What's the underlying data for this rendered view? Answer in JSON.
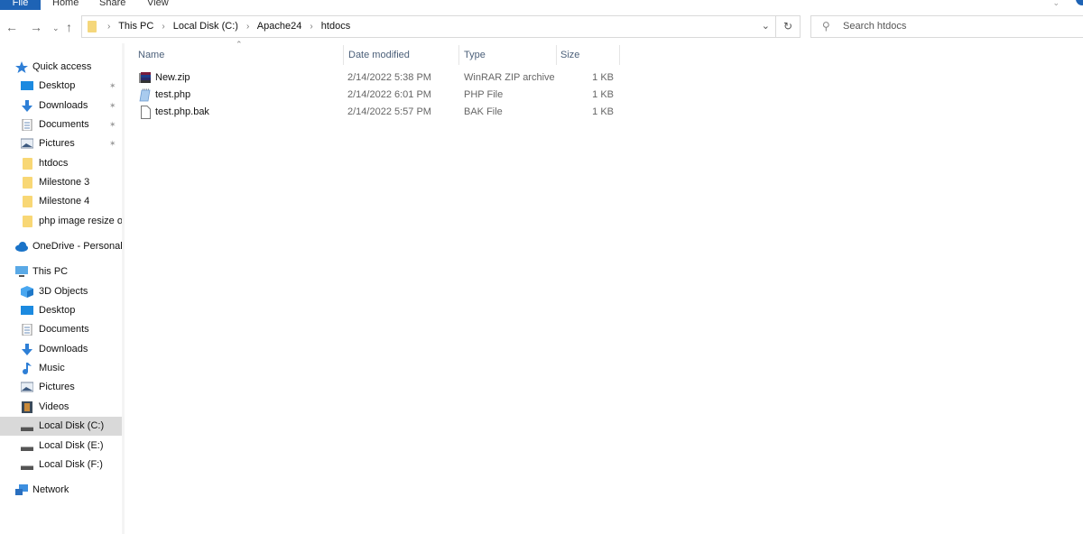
{
  "ribbon": {
    "tabs": [
      {
        "label": "File",
        "active": true
      },
      {
        "label": "Home"
      },
      {
        "label": "Share"
      },
      {
        "label": "View"
      }
    ],
    "accent": "#1e63b5"
  },
  "nav": {
    "back_icon": "arrow-left",
    "forward_icon": "arrow-right",
    "recent_icon": "chevron-down",
    "up_icon": "arrow-up",
    "breadcrumb": [
      "This PC",
      "Local Disk (C:)",
      "Apache24",
      "htdocs"
    ],
    "refresh_icon": "refresh",
    "search_placeholder": "Search htdocs"
  },
  "sidebar": {
    "items": [
      {
        "label": "Quick access",
        "icon": "star-icon",
        "level": 0
      },
      {
        "label": "Desktop",
        "icon": "desktop-icon",
        "level": 1,
        "pinned": true
      },
      {
        "label": "Downloads",
        "icon": "download-icon",
        "level": 1,
        "pinned": true
      },
      {
        "label": "Documents",
        "icon": "document-icon",
        "level": 1,
        "pinned": true
      },
      {
        "label": "Pictures",
        "icon": "pictures-icon",
        "level": 1,
        "pinned": true
      },
      {
        "label": "htdocs",
        "icon": "folder-icon",
        "level": 1
      },
      {
        "label": "Milestone 3",
        "icon": "folder-icon",
        "level": 1
      },
      {
        "label": "Milestone 4",
        "icon": "folder-icon",
        "level": 1
      },
      {
        "label": "php image resize or",
        "icon": "folder-icon",
        "level": 1
      },
      {
        "label": "OneDrive - Personal",
        "icon": "cloud-icon",
        "level": 0
      },
      {
        "label": "This PC",
        "icon": "computer-icon",
        "level": 0
      },
      {
        "label": "3D Objects",
        "icon": "cube-icon",
        "level": 1
      },
      {
        "label": "Desktop",
        "icon": "desktop-icon",
        "level": 1
      },
      {
        "label": "Documents",
        "icon": "document-icon",
        "level": 1
      },
      {
        "label": "Downloads",
        "icon": "download-icon",
        "level": 1
      },
      {
        "label": "Music",
        "icon": "music-icon",
        "level": 1
      },
      {
        "label": "Pictures",
        "icon": "pictures-icon",
        "level": 1
      },
      {
        "label": "Videos",
        "icon": "video-icon",
        "level": 1
      },
      {
        "label": "Local Disk (C:)",
        "icon": "drive-icon",
        "level": 1,
        "selected": true
      },
      {
        "label": "Local Disk (E:)",
        "icon": "drive-icon",
        "level": 1
      },
      {
        "label": "Local Disk (F:)",
        "icon": "drive-icon",
        "level": 1
      },
      {
        "label": "Network",
        "icon": "network-icon",
        "level": 0
      }
    ]
  },
  "filelist": {
    "columns": [
      "Name",
      "Date modified",
      "Type",
      "Size"
    ],
    "sort_column": "Name",
    "rows": [
      {
        "name": "New.zip",
        "date": "2/14/2022 5:38 PM",
        "type": "WinRAR ZIP archive",
        "size": "1 KB",
        "icon": "zip-archive-icon"
      },
      {
        "name": "test.php",
        "date": "2/14/2022 6:01 PM",
        "type": "PHP File",
        "size": "1 KB",
        "icon": "php-file-icon"
      },
      {
        "name": "test.php.bak",
        "date": "2/14/2022 5:57 PM",
        "type": "BAK File",
        "size": "1 KB",
        "icon": "blank-file-icon"
      }
    ]
  }
}
